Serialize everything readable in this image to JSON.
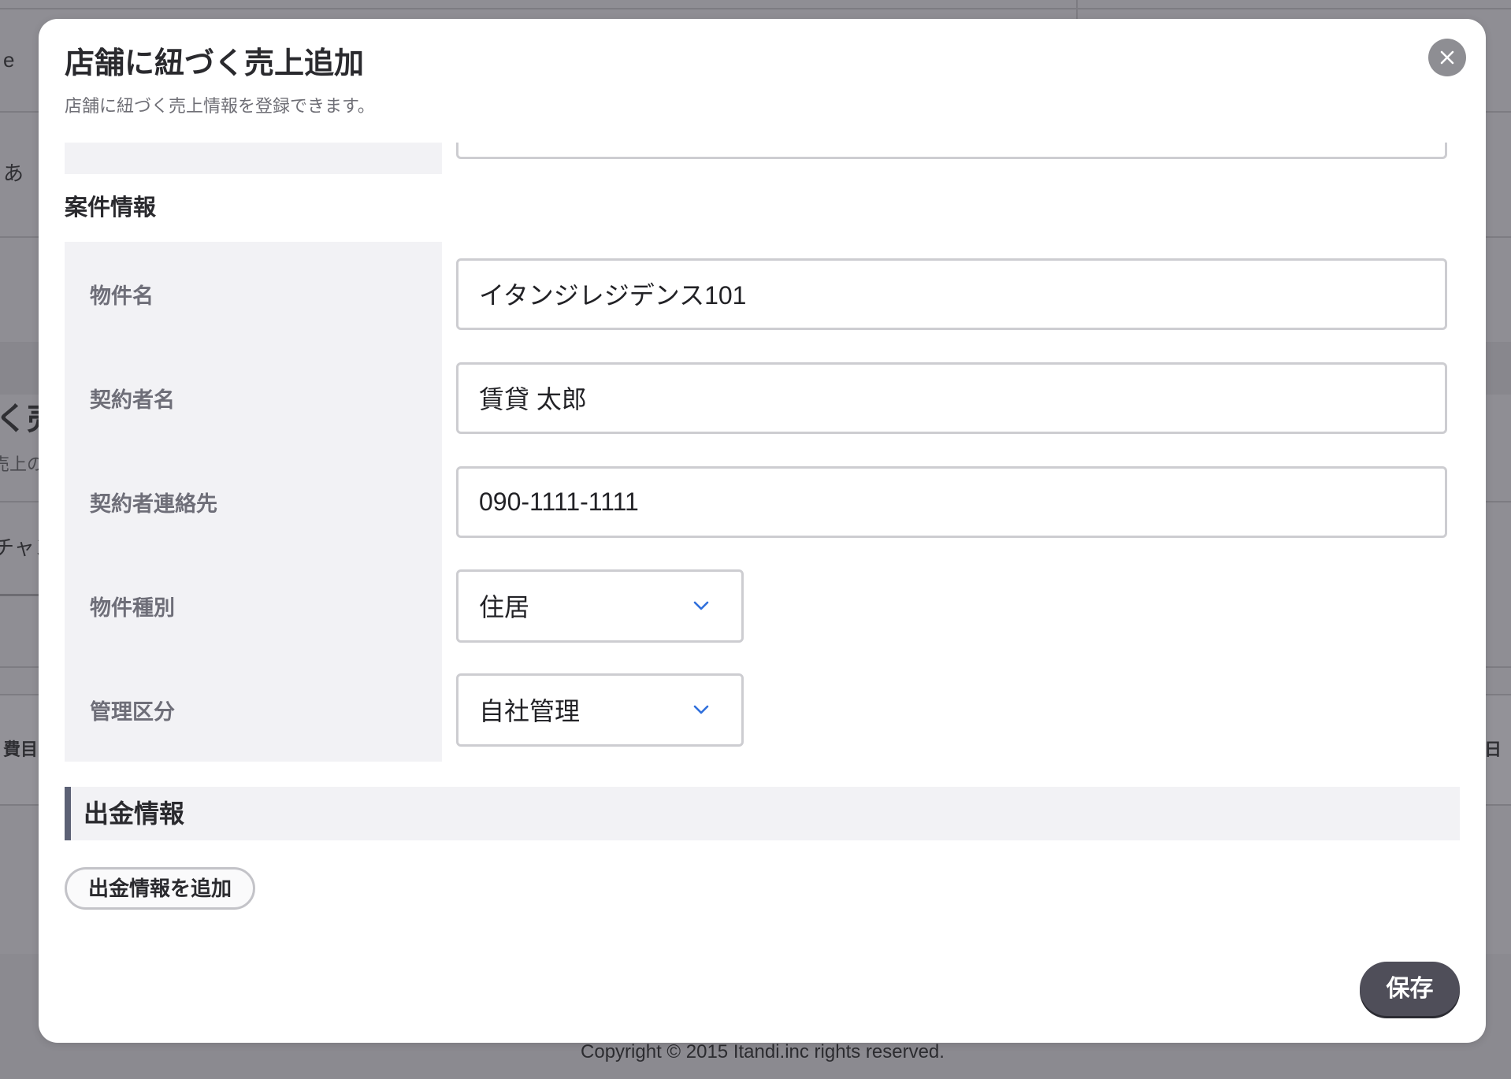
{
  "page": {
    "background_fragments": {
      "e": "e",
      "a": "あ",
      "ku_uri": "く売",
      "uriage_no": "売上の",
      "chan": "チャン",
      "himoku": "費目",
      "hi": "日"
    },
    "footer": "Copyright © 2015 Itandi.inc rights reserved."
  },
  "modal": {
    "title": "店舗に紐づく売上追加",
    "subtitle": "店舗に紐づく売上情報を登録できます。",
    "case_section": {
      "title": "案件情報",
      "fields": [
        {
          "label": "物件名",
          "value": "イタンジレジデンス101"
        },
        {
          "label": "契約者名",
          "value": "賃貸 太郎"
        },
        {
          "label": "契約者連絡先",
          "value": "090-1111-1111"
        },
        {
          "label": "物件種別",
          "selected": "住居"
        },
        {
          "label": "管理区分",
          "selected": "自社管理"
        }
      ]
    },
    "payment_section": {
      "title": "出金情報",
      "add_button_label": "出金情報を追加"
    },
    "save_label": "保存"
  },
  "icons": {
    "close": "close-icon",
    "select_arrow": "chevron-down-icon"
  },
  "colors": {
    "overlay": "#8e8d93",
    "modal_bg": "#ffffff",
    "label_bg": "#f2f2f5",
    "section_accent": "#5c6175",
    "select_arrow": "#2f6fdc",
    "save_button": "#4f4e59",
    "close_button": "#8e8e93"
  }
}
